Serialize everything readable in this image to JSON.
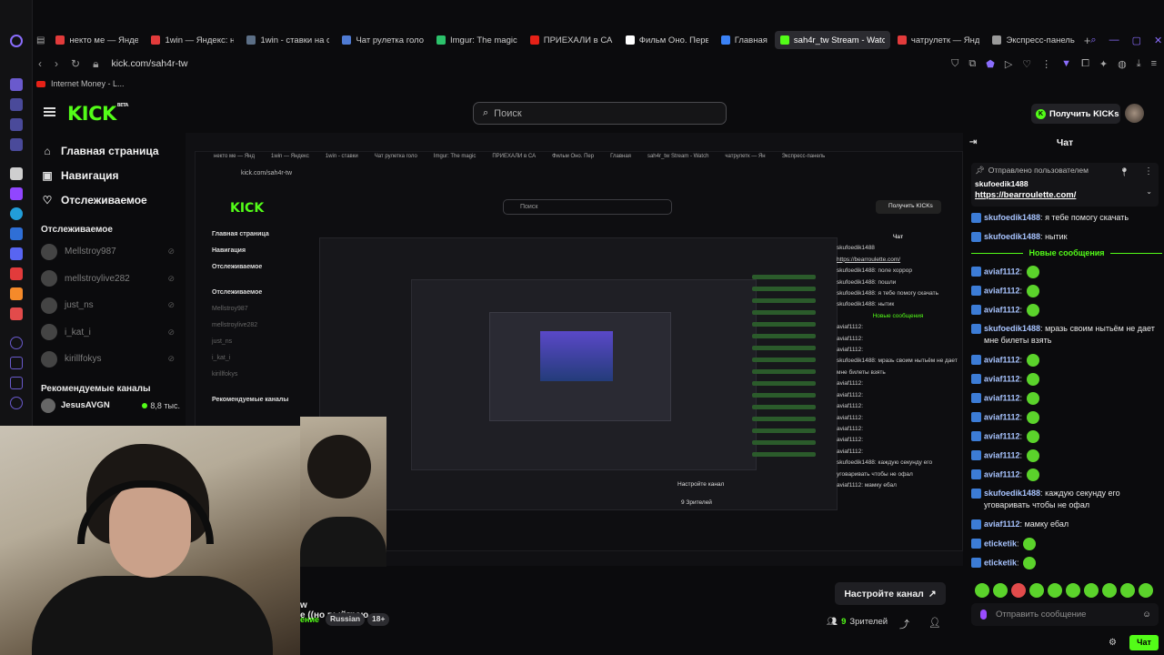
{
  "browser": {
    "tabs": [
      {
        "title": "некто ме — Яндекс",
        "color": "#e23b3b",
        "active": false
      },
      {
        "title": "1win — Яндекс: н",
        "color": "#e23b3b",
        "active": false
      },
      {
        "title": "1win - ставки на с",
        "color": "#5c6f86",
        "active": false
      },
      {
        "title": "Чат рулетка голо",
        "color": "#4f7bd3",
        "active": false
      },
      {
        "title": "Imgur: The magic",
        "color": "#2cc26b",
        "active": false
      },
      {
        "title": "ПРИЕХАЛИ в САМ",
        "color": "#e62117",
        "active": false
      },
      {
        "title": "Фильм Оно. Перв",
        "color": "#ffffff",
        "active": false
      },
      {
        "title": "Главная",
        "color": "#3b82f6",
        "active": false
      },
      {
        "title": "sah4r_tw Stream - Watch",
        "color": "#53fc18",
        "active": true
      },
      {
        "title": "чатрулетк — Янд",
        "color": "#e23b3b",
        "active": false
      },
      {
        "title": "Экспресс-панель",
        "color": "#9a9a9a",
        "active": false
      }
    ],
    "new_tab": "+",
    "url": "kick.com/sah4r-tw",
    "bookmark": "Internet Money - L..."
  },
  "header": {
    "logo": "KICK",
    "logo_beta": "BETA",
    "search_placeholder": "Поиск",
    "get_kicks": "Получить KICKs"
  },
  "sidebar": {
    "nav": [
      {
        "label": "Главная страница",
        "icon": "home-icon",
        "glyph": "⌂"
      },
      {
        "label": "Навигация",
        "icon": "browse-icon",
        "glyph": "▣"
      },
      {
        "label": "Отслеживаемое",
        "icon": "heart-icon",
        "glyph": "♡"
      }
    ],
    "following_title": "Отслеживаемое",
    "following": [
      {
        "name": "Mellstroy987"
      },
      {
        "name": "mellstroylive282"
      },
      {
        "name": "just_ns"
      },
      {
        "name": "i_kat_i"
      },
      {
        "name": "kirillfokys"
      }
    ],
    "recommended_title": "Рекомендуемые каналы",
    "recommended": [
      {
        "name": "JesusAVGN",
        "viewers": "8,8 тыс."
      }
    ]
  },
  "nested": {
    "tabs": [
      "некто ме — Янд",
      "1win — Яндекс",
      "1win - ставки",
      "Чат рулетка голо",
      "Imgur: The magic",
      "ПРИЕХАЛИ в СА",
      "Фильм Оно. Пер",
      "Главная",
      "sah4r_tw Stream - Watch",
      "чатрулетк — Ян",
      "Экспресс-панель"
    ],
    "url": "kick.com/sah4r-tw",
    "side_nav": [
      "Главная страница",
      "Навигация",
      "Отслеживаемое"
    ],
    "side_following_title": "Отслеживаемое",
    "side_following": [
      "Mellstroy987",
      "mellstroylive282",
      "just_ns",
      "i_kat_i",
      "kirillfokys"
    ],
    "side_recommended": "Рекомендуемые каналы",
    "chat_head": "Чат",
    "chat_pinned_user": "skufoedik1488",
    "chat_pinned_link": "https://bearroulette.com/",
    "chat_lines": [
      "skufoedik1488: поле хоррор",
      "skufoedik1488: пошли",
      "skufoedik1488: я тебе помогу скачать",
      "skufoedik1488: нытик",
      "Новые сообщения",
      "aviaf1112:",
      "aviaf1112:",
      "aviaf1112:",
      "skufoedik1488: мразь своим нытьём не дает мне билеты взять",
      "aviaf1112:",
      "aviaf1112:",
      "aviaf1112:",
      "aviaf1112:",
      "aviaf1112:",
      "aviaf1112:",
      "aviaf1112:",
      "skufoedik1488: каждую секунду его уговаривать чтобы не офал",
      "aviaf1112: мамку ебал"
    ],
    "set_channel": "Настройте канал",
    "viewers": "9 Зрителей",
    "send_placeholder": "Отправить сообщение",
    "send_btn": "Чат",
    "stream_title": "w",
    "stream_subtitle": "е ((но выйграю",
    "stream_tag1": "Russian",
    "stream_tag2": "18+"
  },
  "stream_info": {
    "title": "w",
    "subtitle": "е ((но выйграю",
    "category": "ение",
    "tags": [
      "Russian",
      "18+"
    ]
  },
  "actions": {
    "set_channel": "Настройте канал",
    "viewers_count": "9",
    "viewers_label": "Зрителей"
  },
  "chat": {
    "title": "Чат",
    "pinned_header": "Отправлено пользователем",
    "pinned_user": "skufoedik1488",
    "pinned_link": "https://bearroulette.com/",
    "before_new": [
      {
        "user": "skufoedik1488",
        "text": "я тебе помогу скачать"
      },
      {
        "user": "skufoedik1488",
        "text": "нытик"
      }
    ],
    "new_label": "Новые сообщения",
    "after_new": [
      {
        "user": "aviaf1112",
        "text": "",
        "emote": true
      },
      {
        "user": "aviaf1112",
        "text": "",
        "emote": true
      },
      {
        "user": "aviaf1112",
        "text": "",
        "emote": true
      },
      {
        "user": "skufoedik1488",
        "text": "мразь своим нытьём не дает мне билеты взять",
        "emote": false
      },
      {
        "user": "aviaf1112",
        "text": "",
        "emote": true
      },
      {
        "user": "aviaf1112",
        "text": "",
        "emote": true
      },
      {
        "user": "aviaf1112",
        "text": "",
        "emote": true
      },
      {
        "user": "aviaf1112",
        "text": "",
        "emote": true
      },
      {
        "user": "aviaf1112",
        "text": "",
        "emote": true
      },
      {
        "user": "aviaf1112",
        "text": "",
        "emote": true
      },
      {
        "user": "aviaf1112",
        "text": "",
        "emote": true
      },
      {
        "user": "skufoedik1488",
        "text": "каждую секунду его уговаривать чтобы не офал",
        "emote": false
      },
      {
        "user": "aviaf1112",
        "text": "мамку ебал",
        "emote": false
      },
      {
        "user": "eticketik",
        "text": "",
        "emote": true
      },
      {
        "user": "eticketik",
        "text": "",
        "emote": true
      }
    ],
    "input_placeholder": "Отправить сообщение",
    "send_label": "Чат"
  },
  "colors": {
    "brand": "#53fc18",
    "background": "#0b0b0d",
    "browser_accent": "#8a6dfc"
  }
}
